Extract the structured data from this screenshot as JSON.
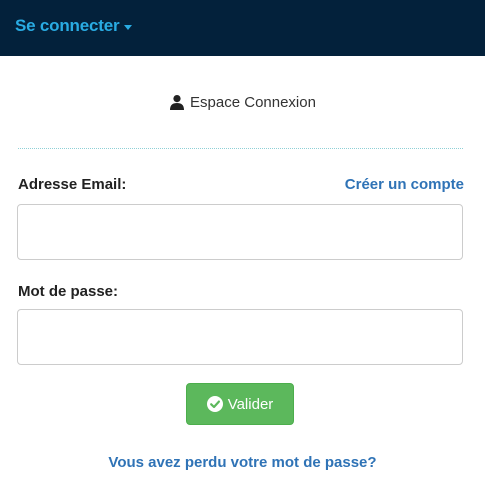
{
  "navbar": {
    "dropdown_label": "Se connecter"
  },
  "panel": {
    "heading": "Espace Connexion"
  },
  "form": {
    "email_label": "Adresse Email:",
    "create_account_link": "Créer un compte",
    "email_value": "",
    "password_label": "Mot de passe:",
    "password_value": "",
    "submit_label": "Valider",
    "forgot_password_link": "Vous avez perdu votre mot de passe?"
  },
  "colors": {
    "navbar_bg": "#03213b",
    "accent": "#29abe2",
    "link": "#2f73b6",
    "success": "#5cb85c"
  }
}
